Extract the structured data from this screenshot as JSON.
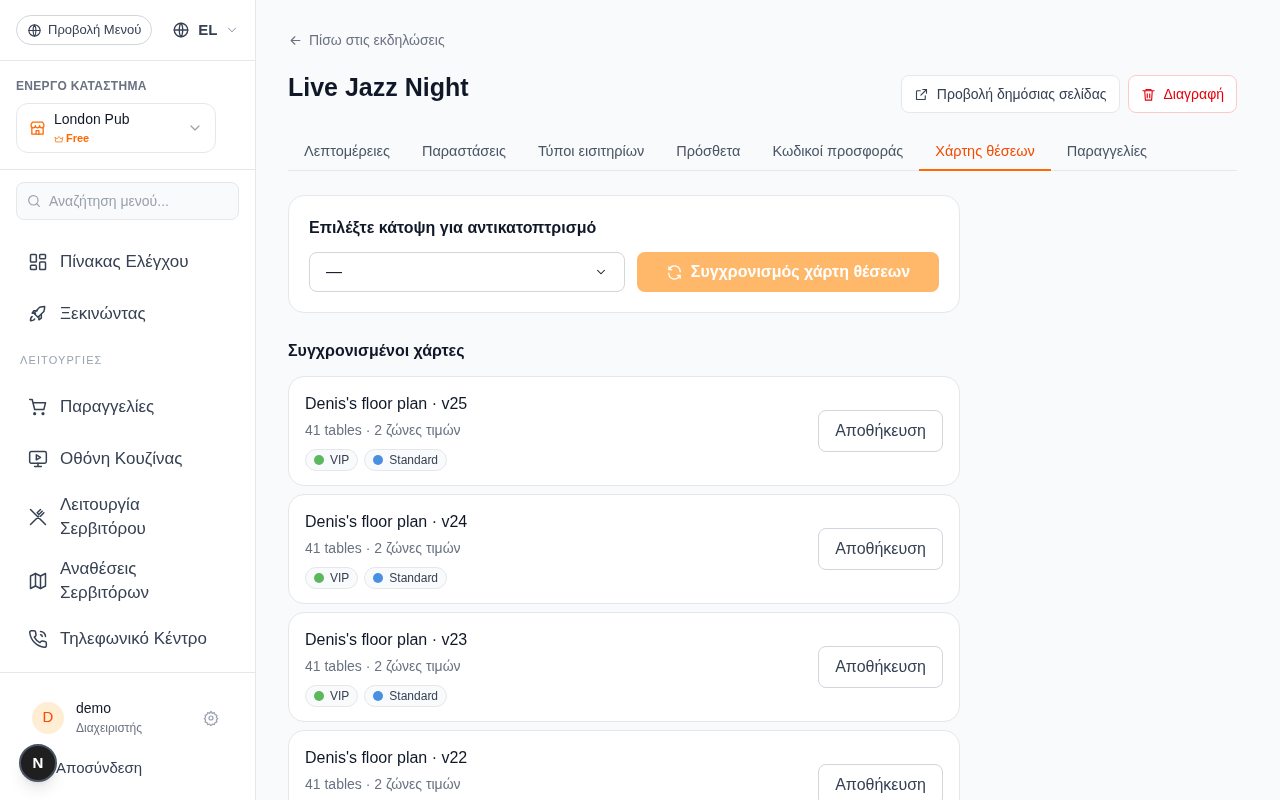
{
  "sidebar": {
    "menu_view_button": "Προβολή Μενού",
    "language": "EL",
    "store_section_label": "ΕΝΕΡΓΟ ΚΑΤΑΣΤΗΜΑ",
    "store": {
      "name": "London Pub",
      "plan": "Free"
    },
    "search": {
      "placeholder": "Αναζήτηση μενού..."
    },
    "groups": [
      {
        "items": [
          {
            "label": "Πίνακας Ελέγχου",
            "kind": "grid"
          },
          {
            "label": "Ξεκινώντας",
            "kind": "rocket"
          }
        ]
      },
      {
        "heading": "ΛΕΙΤΟΥΡΓΙΕΣ",
        "items": [
          {
            "label": "Παραγγελίες",
            "kind": "cart"
          },
          {
            "label": "Οθόνη Κουζίνας",
            "kind": "monitor"
          },
          {
            "label": "Λειτουργία Σερβιτόρου",
            "kind": "utensils"
          },
          {
            "label": "Αναθέσεις Σερβιτόρων",
            "kind": "map"
          },
          {
            "label": "Τηλεφωνικό Κέντρο",
            "kind": "phone"
          }
        ]
      }
    ],
    "user": {
      "initial": "D",
      "name": "demo",
      "role": "Διαχειριστής"
    },
    "logout": "Αποσύνδεση",
    "dev_badge": "N"
  },
  "back_link": "Πίσω στις εκδηλώσεις",
  "title": "Live Jazz Night",
  "actions": [
    {
      "label": "Προβολή δημόσιας σελίδας",
      "kind": "external"
    },
    {
      "label": "Διαγραφή",
      "kind": "danger"
    }
  ],
  "tabs": [
    {
      "label": "Λεπτομέρειες",
      "selected": false
    },
    {
      "label": "Παραστάσεις",
      "selected": false
    },
    {
      "label": "Τύποι εισιτηρίων",
      "selected": false
    },
    {
      "label": "Πρόσθετα",
      "selected": false
    },
    {
      "label": "Κωδικοί προσφοράς",
      "selected": false
    },
    {
      "label": "Χάρτης θέσεων",
      "selected": true
    },
    {
      "label": "Παραγγελίες",
      "selected": false
    }
  ],
  "mirror_panel": {
    "heading": "Επιλέξτε κάτοψη για αντικατοπτρισμό",
    "select_value": "—",
    "sync_button": {
      "label": "Συγχρονισμός χάρτη θέσεων",
      "disabled": true
    }
  },
  "synced_heading": "Συγχρονισμένοι χάρτες",
  "maps": [
    {
      "name": "Denis's floor plan · v25",
      "meta": "41 tables · 2 ζώνες τιμών",
      "tags": [
        {
          "label": "VIP",
          "color": "#5cb85c"
        },
        {
          "label": "Standard",
          "color": "#4a90e2"
        }
      ],
      "button": "Αποθήκευση"
    },
    {
      "name": "Denis's floor plan · v24",
      "meta": "41 tables · 2 ζώνες τιμών",
      "tags": [
        {
          "label": "VIP",
          "color": "#5cb85c"
        },
        {
          "label": "Standard",
          "color": "#4a90e2"
        }
      ],
      "button": "Αποθήκευση"
    },
    {
      "name": "Denis's floor plan · v23",
      "meta": "41 tables · 2 ζώνες τιμών",
      "tags": [
        {
          "label": "VIP",
          "color": "#5cb85c"
        },
        {
          "label": "Standard",
          "color": "#4a90e2"
        }
      ],
      "button": "Αποθήκευση"
    },
    {
      "name": "Denis's floor plan · v22",
      "meta": "41 tables · 2 ζώνες τιμών",
      "button": "Αποθήκευση"
    }
  ]
}
